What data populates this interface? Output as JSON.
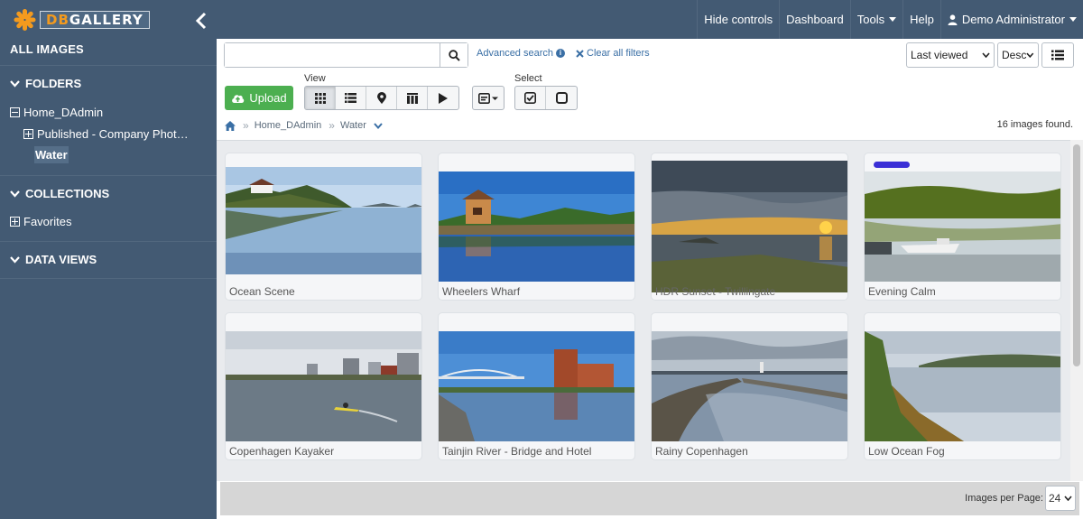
{
  "app": {
    "logo_text_a": "DB",
    "logo_text_b": "GALLERY"
  },
  "topnav": {
    "hide_controls": "Hide controls",
    "dashboard": "Dashboard",
    "tools": "Tools",
    "help": "Help",
    "user": "Demo Administrator"
  },
  "sidebar": {
    "all_images": "ALL IMAGES",
    "folders": "FOLDERS",
    "folder_root": "Home_DAdmin",
    "folder_published": "Published - Company Phot…",
    "folder_water": "Water",
    "collections": "COLLECTIONS",
    "favorites": "Favorites",
    "data_views": "DATA VIEWS"
  },
  "search": {
    "placeholder": "",
    "value": ""
  },
  "links": {
    "advanced_search": "Advanced search",
    "clear_filters": "Clear all filters"
  },
  "sort": {
    "field": "Last viewed",
    "order": "Desc"
  },
  "toolbar": {
    "upload": "Upload",
    "view_label": "View",
    "select_label": "Select"
  },
  "breadcrumb": {
    "root": "Home_DAdmin",
    "current": "Water"
  },
  "results": {
    "found": "16 images found."
  },
  "images": [
    {
      "caption": "Ocean Scene",
      "badge": false
    },
    {
      "caption": "Wheelers Wharf",
      "badge": false
    },
    {
      "caption": "HDR Sunset - Twillingate",
      "badge": false
    },
    {
      "caption": "Evening Calm",
      "badge": true
    },
    {
      "caption": "Copenhagen Kayaker",
      "badge": false
    },
    {
      "caption": "Tainjin River - Bridge and Hotel",
      "badge": false
    },
    {
      "caption": "Rainy Copenhagen",
      "badge": false
    },
    {
      "caption": "Low Ocean Fog",
      "badge": false
    }
  ],
  "pagination": {
    "label": "Images per Page:",
    "value": "24"
  },
  "colors": {
    "sidebar": "#435a73",
    "accent": "#3a6fa5",
    "upload": "#4caf50",
    "logo_orange": "#f39a1e",
    "badge": "#3a2fd6"
  }
}
